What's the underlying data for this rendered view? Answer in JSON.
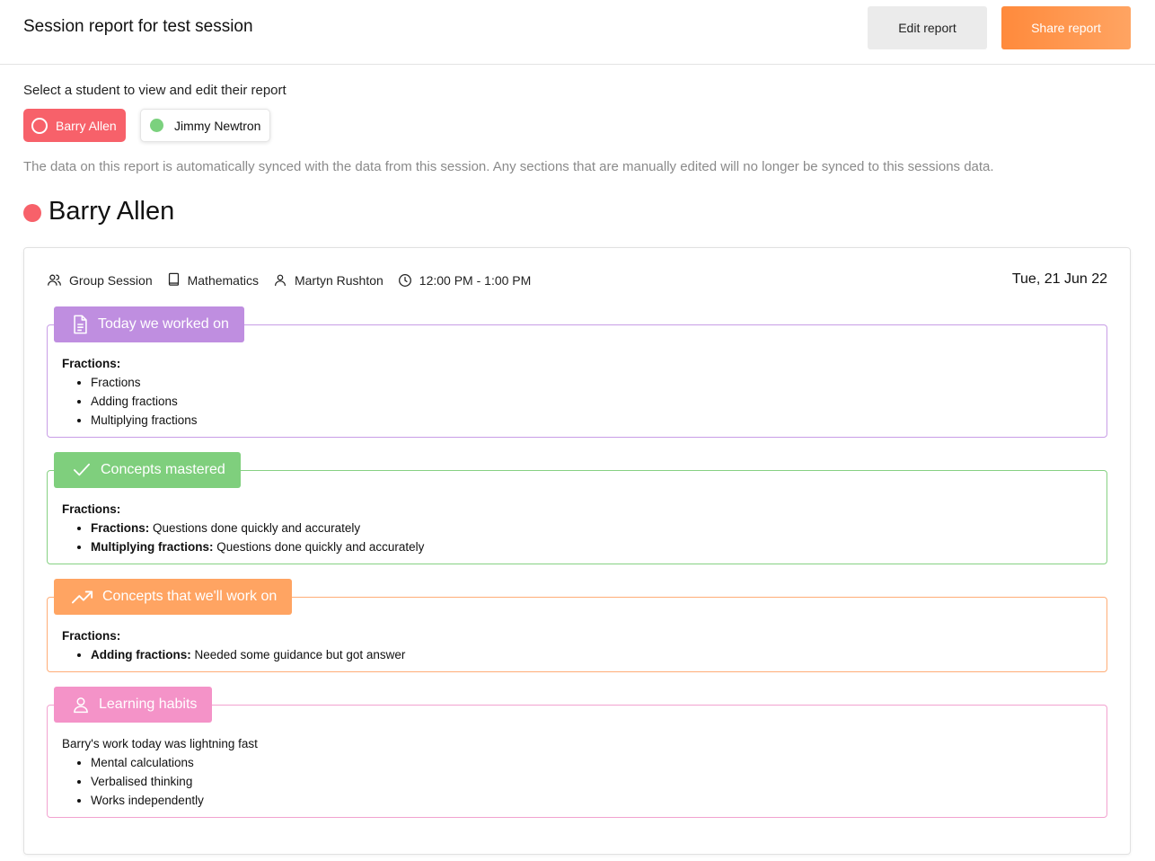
{
  "header": {
    "title": "Session report for test session",
    "edit_label": "Edit report",
    "share_label": "Share report"
  },
  "selector": {
    "label": "Select a student to view and edit their report",
    "students": [
      {
        "name": "Barry Allen",
        "color": "#f7616a"
      },
      {
        "name": "Jimmy Newtron",
        "color": "#7bd17e"
      }
    ],
    "note": "The data on this report is automatically synced with the data from this session. Any sections that are manually edited will no longer be synced to this sessions data."
  },
  "report": {
    "student": "Barry Allen",
    "meta": {
      "session_type": "Group Session",
      "subject": "Mathematics",
      "tutor": "Martyn Rushton",
      "time": "12:00 PM - 1:00 PM",
      "date": "Tue, 21 Jun 22"
    },
    "sections": {
      "worked_on": {
        "title": "Today we worked on",
        "color": "#bf8ee0",
        "heading": "Fractions:",
        "items": [
          "Fractions",
          "Adding fractions",
          "Multiplying fractions"
        ]
      },
      "mastered": {
        "title": "Concepts mastered",
        "color": "#7fcf7d",
        "heading": "Fractions:",
        "items": [
          {
            "name": "Fractions:",
            "note": "Questions done quickly and accurately"
          },
          {
            "name": "Multiplying fractions:",
            "note": "Questions done quickly and accurately"
          }
        ]
      },
      "work_on": {
        "title": "Concepts that we'll work on",
        "color": "#ffa462",
        "heading": "Fractions:",
        "items": [
          {
            "name": "Adding fractions:",
            "note": "Needed some guidance but got answer"
          }
        ]
      },
      "habits": {
        "title": "Learning habits",
        "color": "#f493c8",
        "intro": "Barry's work today was lightning fast",
        "items": [
          "Mental calculations",
          "Verbalised thinking",
          "Works independently"
        ]
      }
    }
  }
}
